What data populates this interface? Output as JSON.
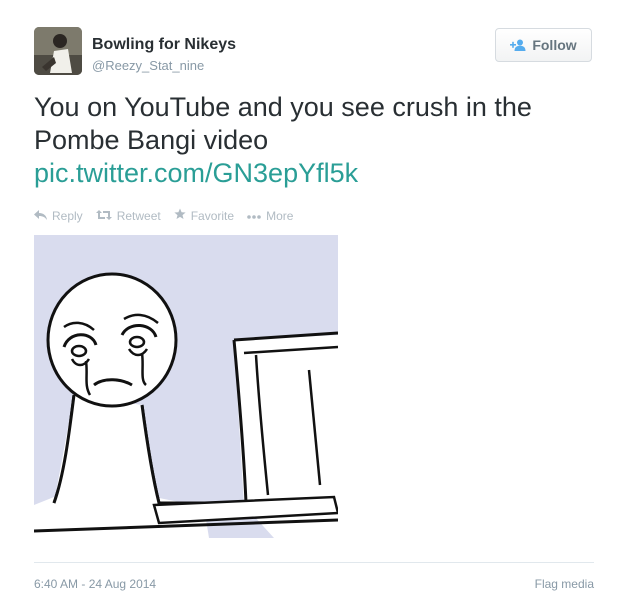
{
  "user": {
    "display_name": "Bowling for Nikeys",
    "handle": "@Reezy_Stat_nine"
  },
  "follow_button": {
    "label": "Follow",
    "icon": "add-user-icon"
  },
  "tweet": {
    "text": "You on YouTube and you see crush in the Pombe Bangi video",
    "link": "pic.twitter.com/GN3epYfl5k"
  },
  "actions": [
    {
      "label": "Reply",
      "icon": "reply-icon"
    },
    {
      "label": "Retweet",
      "icon": "retweet-icon"
    },
    {
      "label": "Favorite",
      "icon": "star-icon"
    },
    {
      "label": "More",
      "icon": "more-dots-icon"
    }
  ],
  "media": {
    "kind": "crying-meme-drawing"
  },
  "footer": {
    "timestamp": "6:40 AM - 24 Aug 2014",
    "flag_label": "Flag media"
  },
  "colors": {
    "link": "#2a9e96",
    "muted": "#8899a6",
    "media_bg": "#d9dcee"
  }
}
